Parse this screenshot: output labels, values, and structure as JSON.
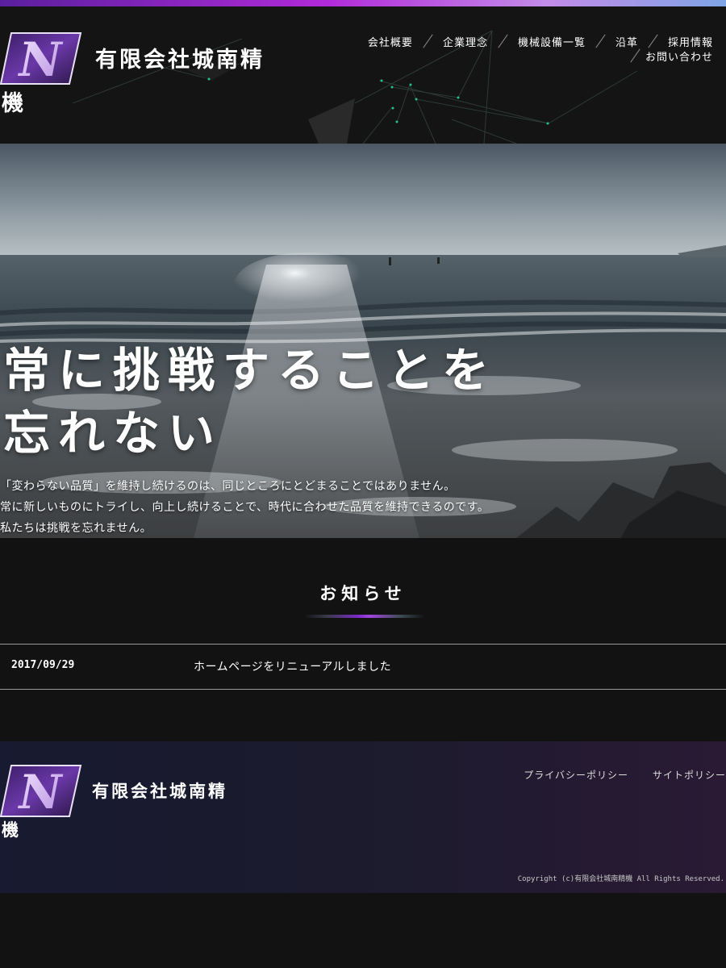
{
  "brand": {
    "name_line1": "有限会社城南精",
    "name_line2": "機",
    "logo_letter": "N",
    "accent_colors": [
      "#5a1f9e",
      "#b12ad9",
      "#c38be8",
      "#7fa5e6"
    ]
  },
  "nav": {
    "items": [
      {
        "label": "会社概要"
      },
      {
        "label": "企業理念"
      },
      {
        "label": "機械設備一覧"
      },
      {
        "label": "沿革"
      },
      {
        "label": "採用情報"
      },
      {
        "label": "お問い合わせ"
      }
    ]
  },
  "hero": {
    "heading_line1": "常に挑戦することを",
    "heading_line2": "忘れない",
    "copy_line1": "「変わらない品質」を維持し続けるのは、同じところにとどまることではありません。",
    "copy_line2": "常に新しいものにトライし、向上し続けることで、時代に合わせた品質を維持できるのです。",
    "copy_line3": "私たちは挑戦を忘れません。"
  },
  "news": {
    "title": "お知らせ",
    "items": [
      {
        "date": "2017/09/29",
        "text": "ホームページをリニューアルしました"
      }
    ]
  },
  "footer": {
    "name_line1": "有限会社城南精",
    "name_line2": "機",
    "links": [
      {
        "label": "プライバシーポリシー"
      },
      {
        "label": "サイトポリシー"
      }
    ],
    "copyright": "Copyright (c)有限会社城南精機 All Rights Reserved."
  }
}
